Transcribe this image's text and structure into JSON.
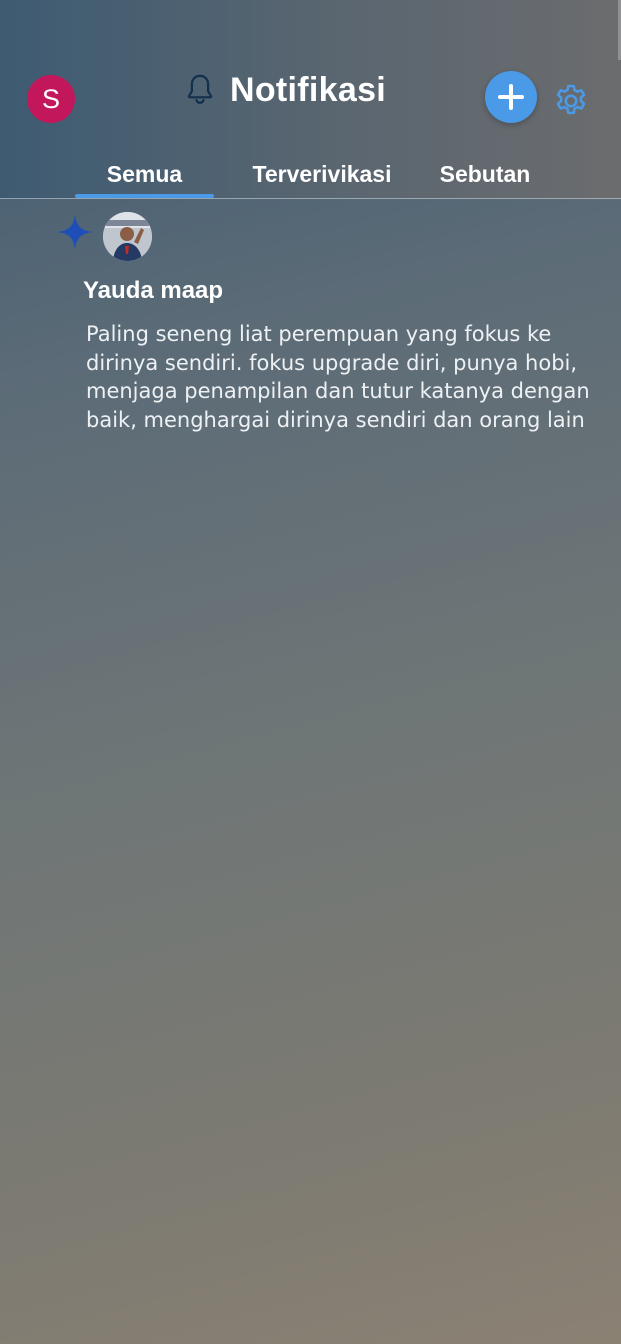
{
  "header": {
    "profile_initial": "S",
    "title": "Notifikasi",
    "bell_icon": "bell-outline-icon",
    "compose_icon": "plus-icon",
    "settings_icon": "gear-icon"
  },
  "tabs": [
    {
      "label": "Semua",
      "active": true
    },
    {
      "label": "Terverivikasi",
      "active": false
    },
    {
      "label": "Sebutan",
      "active": false
    }
  ],
  "notifications": [
    {
      "type_icon": "sparkle-icon",
      "user_name": "Yauda maap",
      "text": "Paling seneng liat perempuan yang fokus ke\ndirinya sendiri. fokus upgrade diri, punya hobi,\nmenjaga penampilan dan tutur katanya dengan\nbaik, menghargai dirinya sendiri dan orang lain"
    }
  ],
  "colors": {
    "accent": "#4a9ae8",
    "avatar_bg": "#c2185b",
    "sparkle": "#1e4fb8"
  }
}
